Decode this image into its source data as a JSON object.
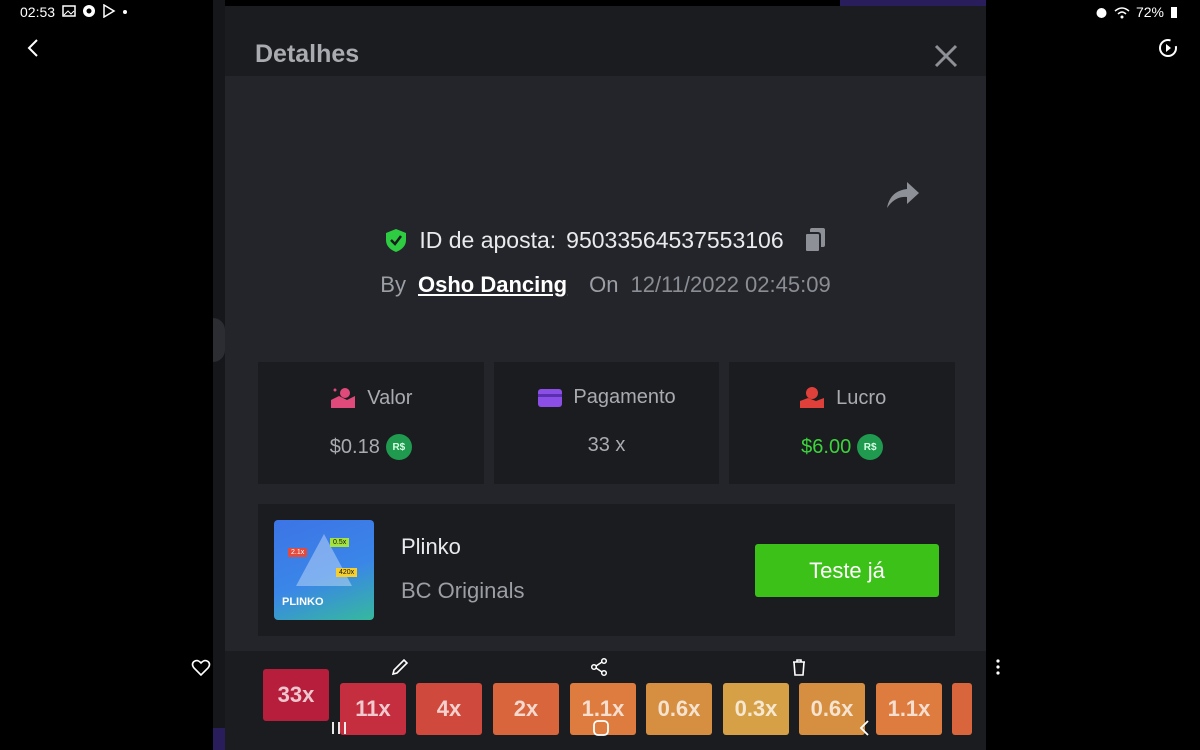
{
  "status_bar": {
    "time": "02:53",
    "battery": "72%"
  },
  "modal": {
    "title": "Detalhes",
    "bet_id_label": "ID de aposta:",
    "bet_id": "95033564537553106",
    "by_label": "By",
    "username": "Osho Dancing",
    "on_label": "On",
    "datetime": "12/11/2022 02:45:09"
  },
  "cards": {
    "valor": {
      "label": "Valor",
      "value": "$0.18",
      "coin": "R$"
    },
    "pagamento": {
      "label": "Pagamento",
      "value": "33 x"
    },
    "lucro": {
      "label": "Lucro",
      "value": "$6.00",
      "coin": "R$"
    }
  },
  "game": {
    "name": "Plinko",
    "provider": "BC Originals",
    "play_label": "Teste já",
    "thumb_label": "PLINKO",
    "thumb_tags": [
      "2.1x",
      "0.5x",
      "420x"
    ]
  },
  "multipliers": [
    "33x",
    "11x",
    "4x",
    "2x",
    "1.1x",
    "0.6x",
    "0.3x",
    "0.6x",
    "1.1x"
  ],
  "colors": {
    "accent_green": "#3bc117",
    "profit_green": "#3bd43b",
    "shield_green": "#2ecc40"
  }
}
